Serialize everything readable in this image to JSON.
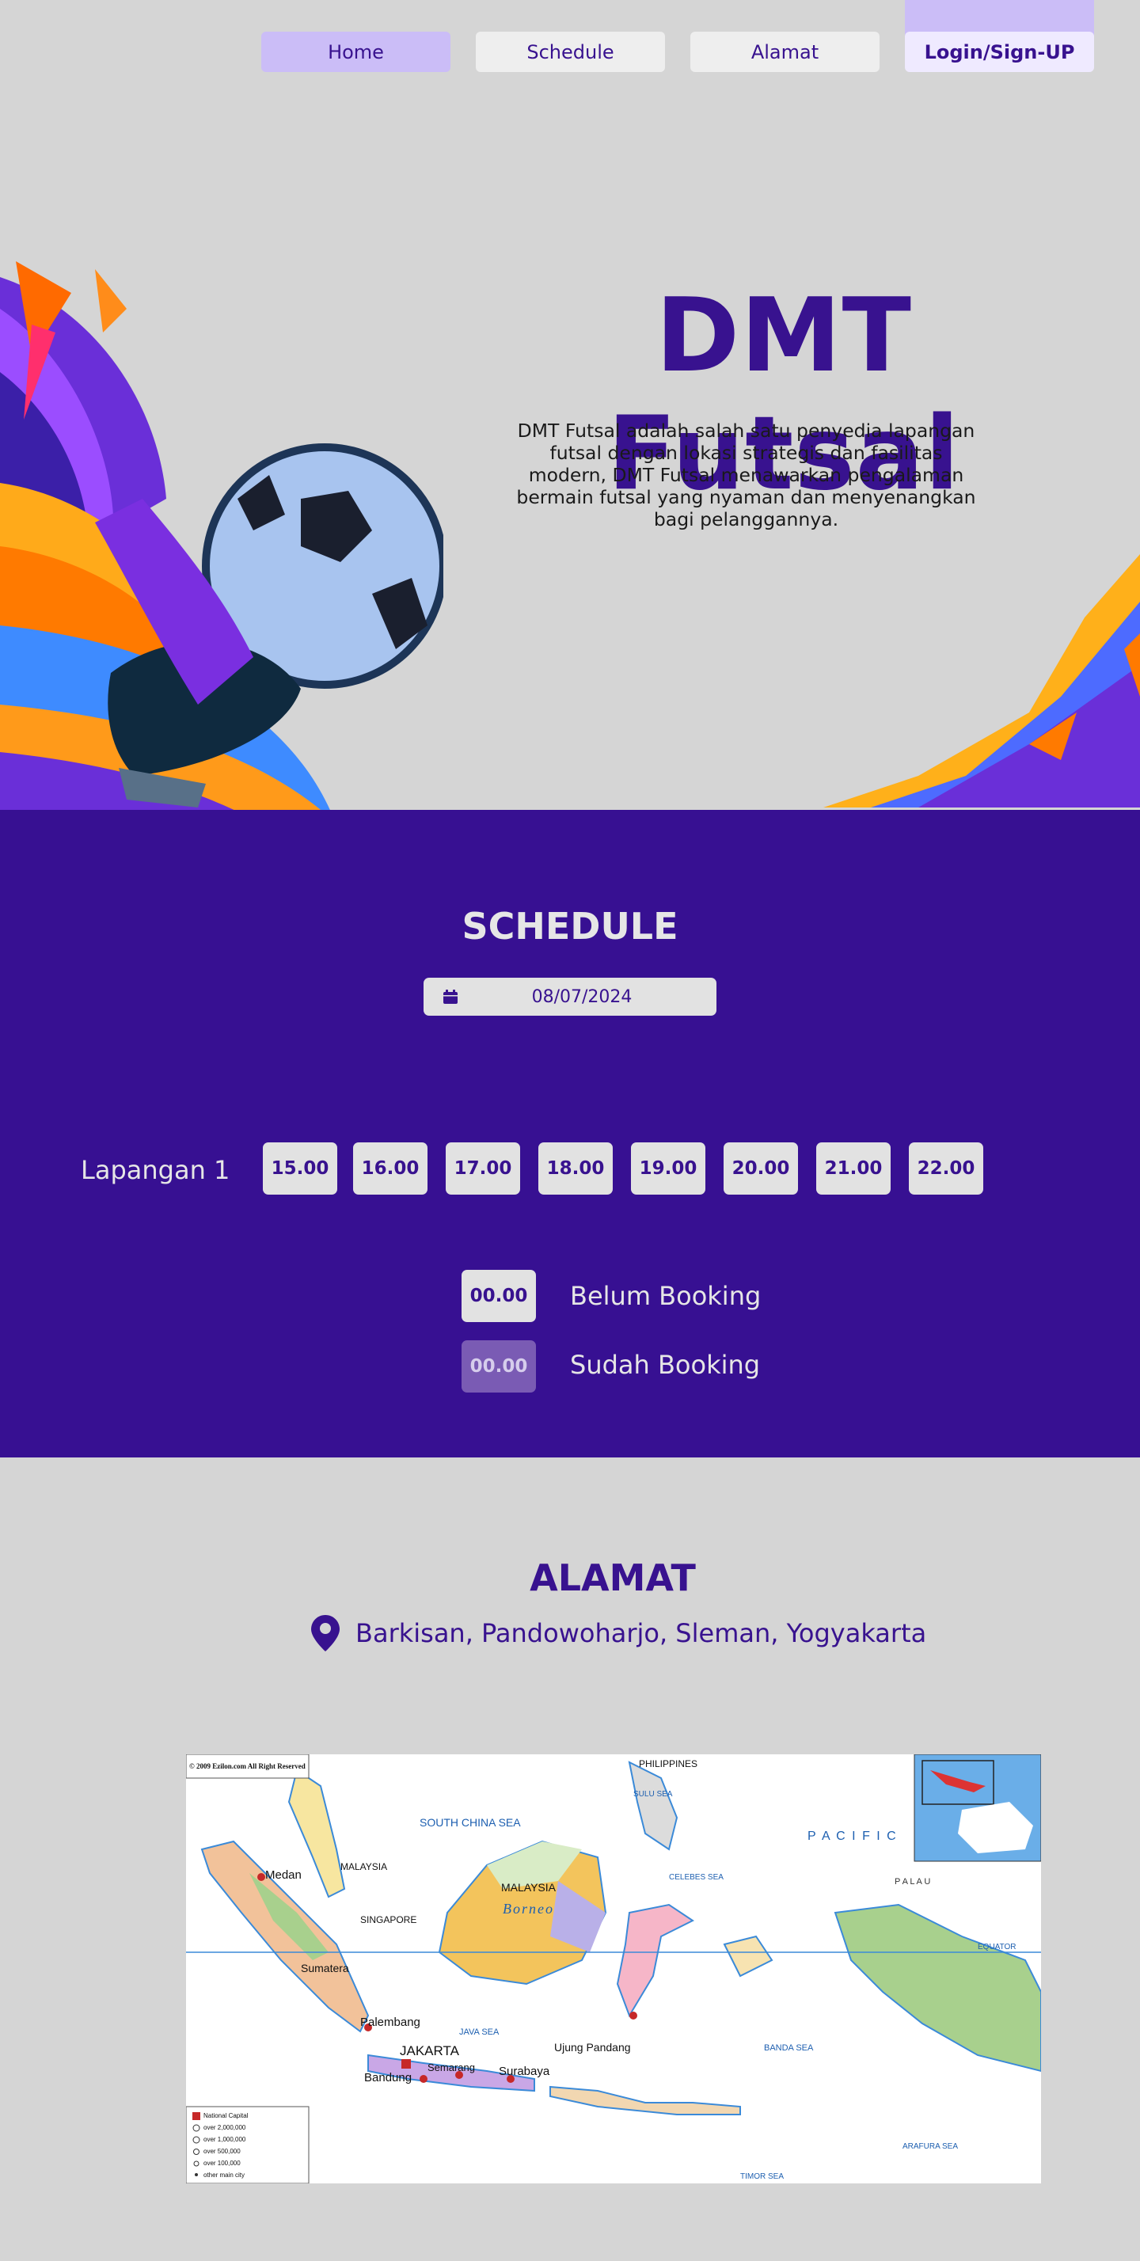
{
  "nav": {
    "home": "Home",
    "schedule": "Schedule",
    "alamat": "Alamat",
    "login": "Login/Sign-UP"
  },
  "hero": {
    "title": "DMT Futsal",
    "description": "DMT Futsal adalah salah satu penyedia lapangan futsal dengan lokasi strategis dan fasilitas modern, DMT Futsal menawarkan pengalaman bermain futsal yang nyaman dan menyenangkan bagi pelanggannya."
  },
  "schedule": {
    "title": "SCHEDULE",
    "date": "08/07/2024",
    "court": "Lapangan 1",
    "slots": [
      "15.00",
      "16.00",
      "17.00",
      "18.00",
      "19.00",
      "20.00",
      "21.00",
      "22.00"
    ],
    "legend": {
      "free_time": "00.00",
      "free_label": "Belum Booking",
      "booked_time": "00.00",
      "booked_label": "Sudah Booking"
    }
  },
  "alamat": {
    "title": "ALAMAT",
    "address": "Barkisan, Pandowoharjo, Sleman, Yogyakarta"
  },
  "map": {
    "copyright": "© 2009 Ezilon.com All Right Reserved",
    "labels": {
      "south_china_sea": "SOUTH CHINA SEA",
      "pacific": "P A C I F I C",
      "malaysia": "MALAYSIA",
      "malaysia2": "MALAYSIA",
      "borneo": "Borneo",
      "singapore": "SINGAPORE",
      "jakarta": "JAKARTA",
      "java_sea": "JAVA SEA",
      "banda_sea": "BANDA SEA",
      "celebes_sea": "CELEBES SEA",
      "sulu_sea": "SULU SEA",
      "philippines": "PHILIPPINES",
      "timor_sea": "TIMOR SEA",
      "arafura_sea": "ARAFURA SEA",
      "medan": "Medan",
      "palembang": "Palembang",
      "bandung": "Bandung",
      "semarang": "Semarang",
      "surabaya": "Surabaya",
      "ujung_pandang": "Ujung Pandang",
      "sumatera": "Sumatera",
      "equator": "EQUATOR",
      "palau": "P A L A U"
    },
    "legend": [
      "National Capital",
      "over 2,000,000",
      "over 1,000,000",
      "over 500,000",
      "over 100,000",
      "other main city"
    ]
  },
  "colors": {
    "brand": "#38128f",
    "nav_active": "#cbbdf7",
    "page_bg": "#d5d5d5",
    "booked": "#7a5bb4"
  }
}
